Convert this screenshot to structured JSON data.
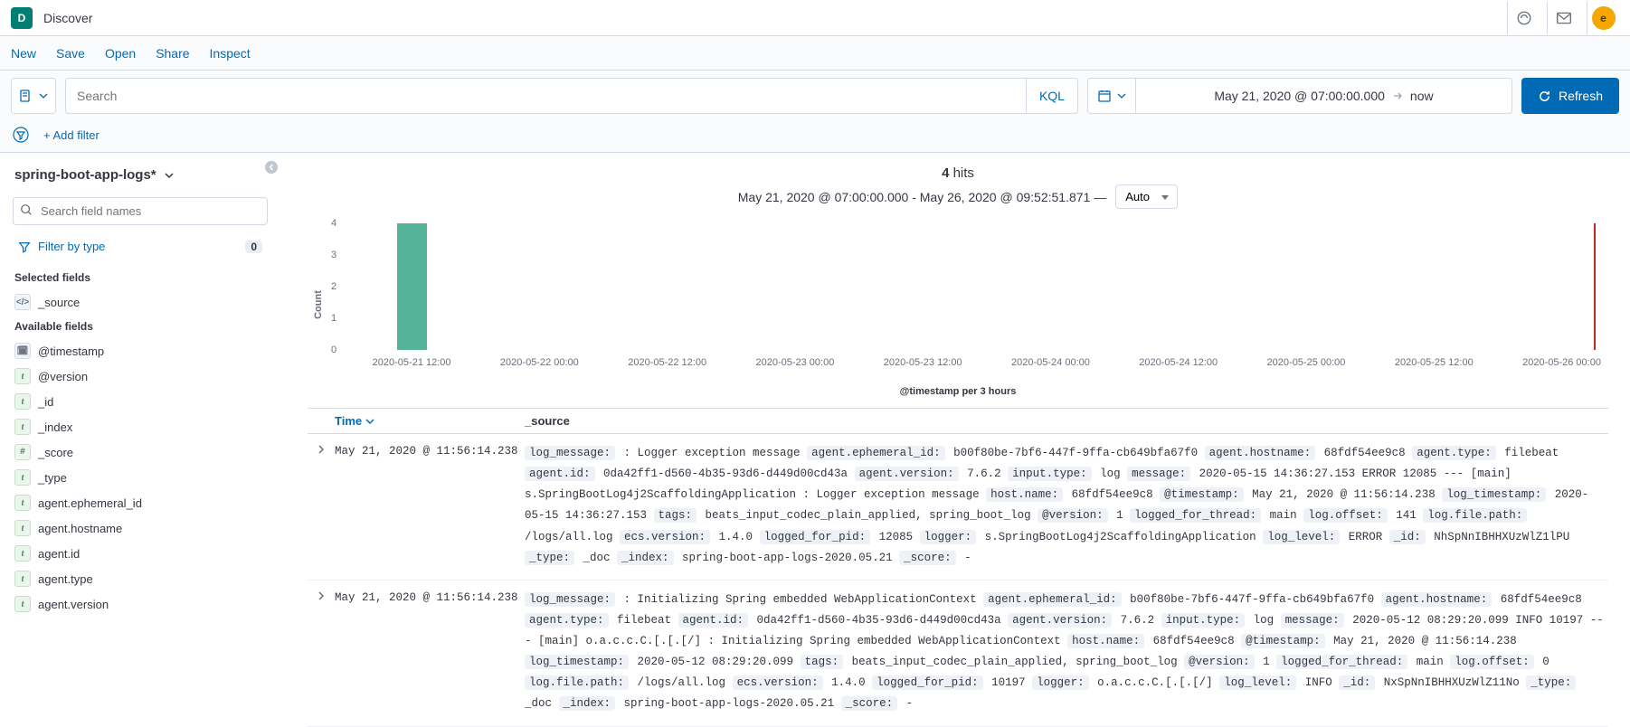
{
  "topbar": {
    "app_initial": "D",
    "title": "Discover",
    "user_initial": "e"
  },
  "menu": {
    "new": "New",
    "save": "Save",
    "open": "Open",
    "share": "Share",
    "inspect": "Inspect"
  },
  "query": {
    "placeholder": "Search",
    "kql_label": "KQL"
  },
  "datepicker": {
    "from": "May 21, 2020 @ 07:00:00.000",
    "to": "now"
  },
  "refresh_label": "Refresh",
  "add_filter_label": "+ Add filter",
  "sidebar": {
    "index_pattern": "spring-boot-app-logs*",
    "search_placeholder": "Search field names",
    "filter_by_type": "Filter by type",
    "filter_type_count": "0",
    "selected_label": "Selected fields",
    "available_label": "Available fields",
    "selected_fields": [
      {
        "icon": "source",
        "glyph": "</>",
        "name": "_source"
      }
    ],
    "available_fields": [
      {
        "icon": "date",
        "glyph": "🗓",
        "name": "@timestamp"
      },
      {
        "icon": "text",
        "glyph": "t",
        "name": "@version"
      },
      {
        "icon": "text",
        "glyph": "t",
        "name": "_id"
      },
      {
        "icon": "text",
        "glyph": "t",
        "name": "_index"
      },
      {
        "icon": "num",
        "glyph": "#",
        "name": "_score"
      },
      {
        "icon": "text",
        "glyph": "t",
        "name": "_type"
      },
      {
        "icon": "text",
        "glyph": "t",
        "name": "agent.ephemeral_id"
      },
      {
        "icon": "text",
        "glyph": "t",
        "name": "agent.hostname"
      },
      {
        "icon": "text",
        "glyph": "t",
        "name": "agent.id"
      },
      {
        "icon": "text",
        "glyph": "t",
        "name": "agent.type"
      },
      {
        "icon": "text",
        "glyph": "t",
        "name": "agent.version"
      }
    ]
  },
  "hits": {
    "count": "4",
    "label": "hits",
    "range_text": "May 21, 2020 @ 07:00:00.000 - May 26, 2020 @ 09:52:51.871 —",
    "interval": "Auto"
  },
  "chart_data": {
    "type": "bar",
    "ylabel": "Count",
    "xlabel": "@timestamp per 3 hours",
    "ylim": [
      0,
      4
    ],
    "yticks": [
      0,
      1,
      2,
      3,
      4
    ],
    "categories": [
      "2020-05-21 12:00",
      "2020-05-22 00:00",
      "2020-05-22 12:00",
      "2020-05-23 00:00",
      "2020-05-23 12:00",
      "2020-05-24 00:00",
      "2020-05-24 12:00",
      "2020-05-25 00:00",
      "2020-05-25 12:00",
      "2020-05-26 00:00"
    ],
    "bars": [
      {
        "bucket": "2020-05-21 12:00",
        "value": 4
      }
    ]
  },
  "table": {
    "time_header": "Time",
    "source_header": "_source"
  },
  "docs": [
    {
      "time": "May 21, 2020 @ 11:56:14.238",
      "fields": [
        {
          "k": "log_message:",
          "v": ": Logger exception message"
        },
        {
          "k": "agent.ephemeral_id:",
          "v": "b00f80be-7bf6-447f-9ffa-cb649bfa67f0"
        },
        {
          "k": "agent.hostname:",
          "v": "68fdf54ee9c8"
        },
        {
          "k": "agent.type:",
          "v": "filebeat"
        },
        {
          "k": "agent.id:",
          "v": "0da42ff1-d560-4b35-93d6-d449d00cd43a"
        },
        {
          "k": "agent.version:",
          "v": "7.6.2"
        },
        {
          "k": "input.type:",
          "v": "log"
        },
        {
          "k": "message:",
          "v": "2020-05-15 14:36:27.153 ERROR 12085 --- [main] s.SpringBootLog4j2ScaffoldingApplication : Logger exception message"
        },
        {
          "k": "host.name:",
          "v": "68fdf54ee9c8"
        },
        {
          "k": "@timestamp:",
          "v": "May 21, 2020 @ 11:56:14.238"
        },
        {
          "k": "log_timestamp:",
          "v": "2020-05-15 14:36:27.153"
        },
        {
          "k": "tags:",
          "v": "beats_input_codec_plain_applied, spring_boot_log"
        },
        {
          "k": "@version:",
          "v": "1"
        },
        {
          "k": "logged_for_thread:",
          "v": "main"
        },
        {
          "k": "log.offset:",
          "v": "141"
        },
        {
          "k": "log.file.path:",
          "v": "/logs/all.log"
        },
        {
          "k": "ecs.version:",
          "v": "1.4.0"
        },
        {
          "k": "logged_for_pid:",
          "v": "12085"
        },
        {
          "k": "logger:",
          "v": "s.SpringBootLog4j2ScaffoldingApplication"
        },
        {
          "k": "log_level:",
          "v": "ERROR"
        },
        {
          "k": "_id:",
          "v": "NhSpNnIBHHXUzWlZ1lPU"
        },
        {
          "k": "_type:",
          "v": "_doc"
        },
        {
          "k": "_index:",
          "v": "spring-boot-app-logs-2020.05.21"
        },
        {
          "k": "_score:",
          "v": " -"
        }
      ]
    },
    {
      "time": "May 21, 2020 @ 11:56:14.238",
      "fields": [
        {
          "k": "log_message:",
          "v": ": Initializing Spring embedded WebApplicationContext"
        },
        {
          "k": "agent.ephemeral_id:",
          "v": "b00f80be-7bf6-447f-9ffa-cb649bfa67f0"
        },
        {
          "k": "agent.hostname:",
          "v": "68fdf54ee9c8"
        },
        {
          "k": "agent.type:",
          "v": "filebeat"
        },
        {
          "k": "agent.id:",
          "v": "0da42ff1-d560-4b35-93d6-d449d00cd43a"
        },
        {
          "k": "agent.version:",
          "v": "7.6.2"
        },
        {
          "k": "input.type:",
          "v": "log"
        },
        {
          "k": "message:",
          "v": "2020-05-12 08:29:20.099 INFO 10197 --- [main] o.a.c.c.C.[.[.[/] : Initializing Spring embedded WebApplicationContext"
        },
        {
          "k": "host.name:",
          "v": "68fdf54ee9c8"
        },
        {
          "k": "@timestamp:",
          "v": "May 21, 2020 @ 11:56:14.238"
        },
        {
          "k": "log_timestamp:",
          "v": "2020-05-12 08:29:20.099"
        },
        {
          "k": "tags:",
          "v": "beats_input_codec_plain_applied, spring_boot_log"
        },
        {
          "k": "@version:",
          "v": "1"
        },
        {
          "k": "logged_for_thread:",
          "v": "main"
        },
        {
          "k": "log.offset:",
          "v": "0"
        },
        {
          "k": "log.file.path:",
          "v": "/logs/all.log"
        },
        {
          "k": "ecs.version:",
          "v": "1.4.0"
        },
        {
          "k": "logged_for_pid:",
          "v": "10197"
        },
        {
          "k": "logger:",
          "v": "o.a.c.c.C.[.[.[/]"
        },
        {
          "k": "log_level:",
          "v": "INFO"
        },
        {
          "k": "_id:",
          "v": "NxSpNnIBHHXUzWlZ11No"
        },
        {
          "k": "_type:",
          "v": "_doc"
        },
        {
          "k": "_index:",
          "v": "spring-boot-app-logs-2020.05.21"
        },
        {
          "k": "_score:",
          "v": " -"
        }
      ]
    }
  ]
}
